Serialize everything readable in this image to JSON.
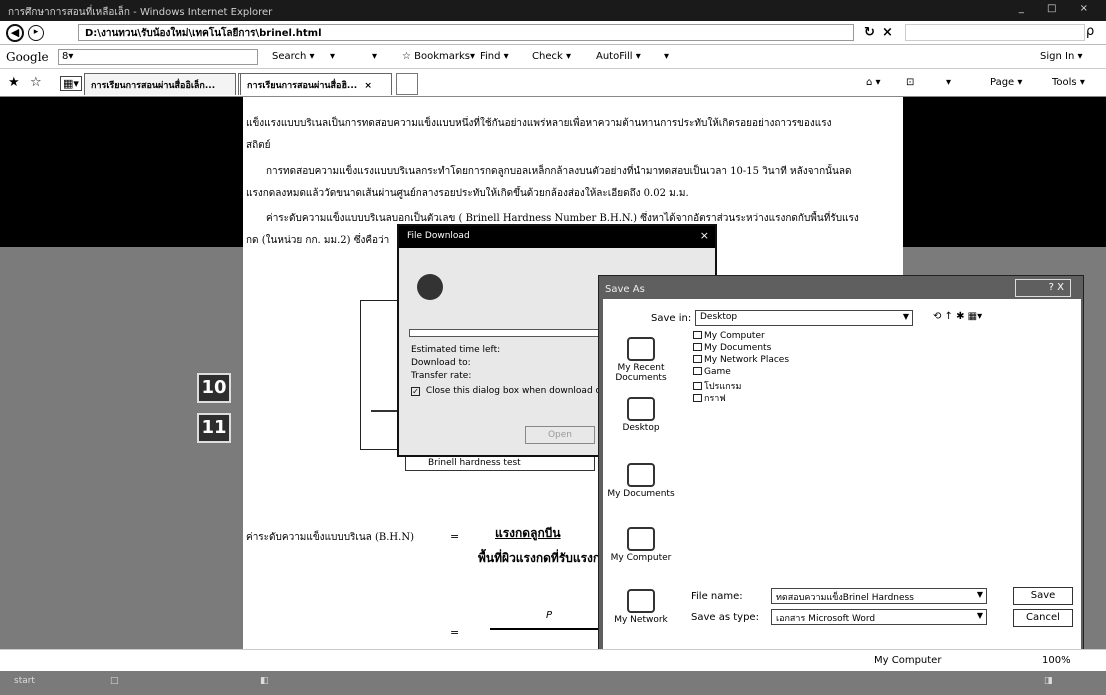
{
  "window": {
    "title": "การศึกษาการสอนที่เหลือเล็ก - Windows Internet Explorer",
    "controls": "_ □ ×"
  },
  "addressbar": {
    "back_label": "◀",
    "forward_label": "▸",
    "url": "D:\\งานทวน\\รับน้องใหม่\\เทคโนโลยีการ\\brinel.html",
    "refresh_label": "↻",
    "stop_label": "×",
    "search_icon": "ρ"
  },
  "googlebar": {
    "label": "Google",
    "dropdown": "8▾",
    "items": [
      {
        "label": "Search ▾"
      },
      {
        "label": "▾"
      },
      {
        "label": "▾"
      },
      {
        "label": "☆ Bookmarks▾"
      },
      {
        "label": "Find ▾"
      },
      {
        "label": "Check ▾"
      },
      {
        "label": "AutoFill ▾"
      },
      {
        "label": "▾"
      }
    ],
    "right": "Sign In ▾"
  },
  "tabbar": {
    "tabs": [
      {
        "label": "การเรียนการสอนผ่านสื่ออิเล็ก..."
      },
      {
        "label": "การเรียนการสอนผ่านสื่อฮิ...",
        "close": "×"
      }
    ],
    "commands": [
      {
        "label": "⌂ ▾"
      },
      {
        "label": "⊡"
      },
      {
        "label": "▾"
      },
      {
        "label": "Page ▾"
      },
      {
        "label": "Tools ▾"
      }
    ]
  },
  "document": {
    "paragraphs": [
      "แข็งแรงแบบบริเนลเป็นการทดสอบความแข็งแบบหนึ่งที่ใช้กันอย่างแพร่หลายเพื่อหาความต้านทานการประทับให้เกิดรอยอย่างถาวรของแรง",
      "สถิตย์",
      "การทดสอบความแข็งแรงแบบบริเนลกระทำโดยการกดลูกบอลเหล็กกล้าลงบนตัวอย่างที่นำมาทดสอบเป็นเวลา 10-15 วินาที หลังจากนั้นลด",
      "แรงกดลงหมดแล้ววัดขนาดเส้นผ่านศูนย์กลางรอยประทับให้เกิดขึ้นด้วยกล้องส่องให้ละเอียดถึง 0.02 ม.ม.",
      "ค่าระดับความแข็งแบบบริเนลบอกเป็นตัวเลข ( Brinell Hardness Number B.H.N.) ซึ่งหาได้จากอัตราส่วนระหว่างแรงกดกับพื้นที่รับแรง",
      "กด (ในหน่วย กก. มม.2) ซึ่งคือว่า"
    ],
    "side_buttons": [
      "10",
      "11"
    ],
    "diagram_caption": "Brinell hardness test",
    "formula_label": "ค่าระดับความแข็งแบบบริเนล (B.H.N)",
    "formula_equals": "=",
    "numerator": "แรงกดลูกบีน",
    "denominator": "พื้นที่ผิวแรงกดที่รับแรงกด",
    "p_term": "P",
    "equals2": "="
  },
  "download_dialog": {
    "title": "File Download",
    "close": "×",
    "estimated_label": "Estimated time left:",
    "download_to_label": "Download to:",
    "transfer_rate_label": "Transfer rate:",
    "close_checkbox_label": "Close this dialog box when download comp",
    "check": "✓",
    "button": "Open"
  },
  "saveas_dialog": {
    "title": "Save As",
    "controls": "? X",
    "save_in_label": "Save in:",
    "save_in_value": "Desktop",
    "toolbar_icons": "⟲ ↑ ✱ ▦▾",
    "places": [
      {
        "label": "My Recent Documents"
      },
      {
        "label": "Desktop"
      },
      {
        "label": "My Documents"
      },
      {
        "label": "My Computer"
      },
      {
        "label": "My Network"
      }
    ],
    "files": [
      {
        "label": "My Computer"
      },
      {
        "label": "My Documents"
      },
      {
        "label": "My Network Places"
      },
      {
        "label": "Game"
      },
      {
        "label": "โปรแกรม"
      },
      {
        "label": "กราฟ"
      }
    ],
    "file_name_label": "File name:",
    "file_name_value": "ทดสอบความแข็งBrinel Hardness",
    "save_type_label": "Save as type:",
    "save_type_value": "เอกสาร Microsoft Word",
    "save_button": "Save",
    "cancel_button": "Cancel"
  },
  "statusbar": {
    "zone": "My Computer",
    "zoom": "100%"
  },
  "taskbar": {
    "items": [
      "start",
      "□",
      "◧",
      "◨"
    ]
  }
}
